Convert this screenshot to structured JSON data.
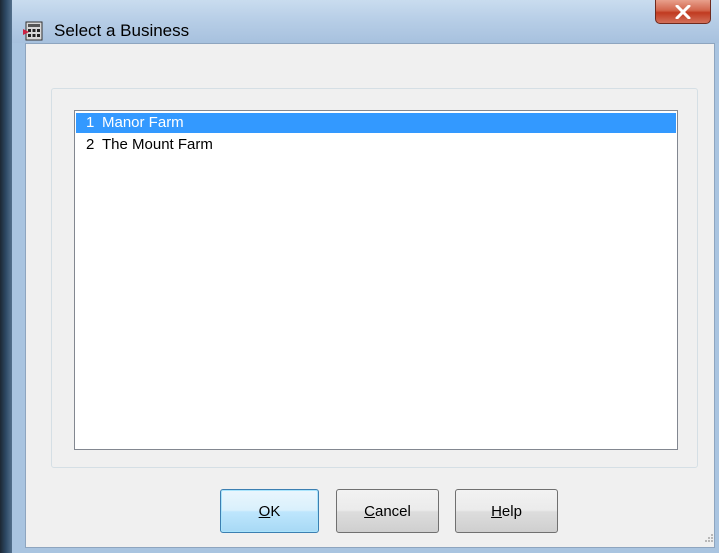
{
  "window": {
    "title": "Select a Business",
    "close_glyph": "X"
  },
  "list": {
    "items": [
      {
        "num": "1",
        "label": "Manor Farm",
        "selected": true
      },
      {
        "num": "2",
        "label": "The Mount Farm",
        "selected": false
      }
    ]
  },
  "buttons": {
    "ok": {
      "mnemonic": "O",
      "rest": "K"
    },
    "cancel": {
      "mnemonic": "C",
      "rest": "ancel"
    },
    "help": {
      "mnemonic": "H",
      "rest": "elp"
    }
  },
  "colors": {
    "selection": "#3399ff",
    "close_button": "#c13a20"
  }
}
